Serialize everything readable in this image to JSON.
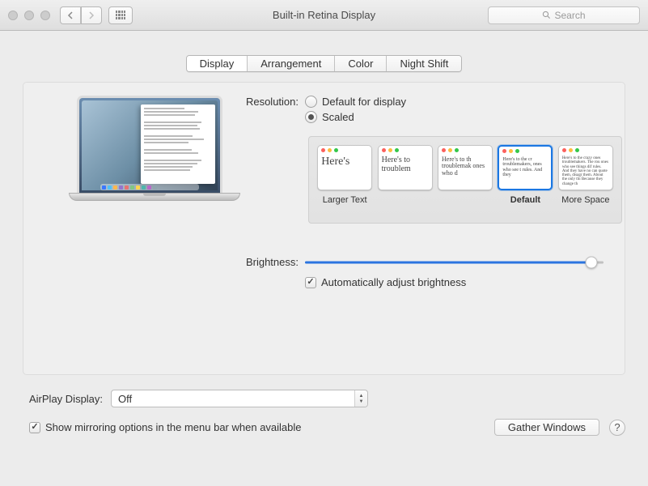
{
  "window": {
    "title": "Built-in Retina Display"
  },
  "search": {
    "placeholder": "Search"
  },
  "tabs": {
    "display": "Display",
    "arrangement": "Arrangement",
    "color": "Color",
    "night": "Night Shift"
  },
  "resolution": {
    "label": "Resolution:",
    "default_for_display": "Default for display",
    "scaled": "Scaled"
  },
  "thumbs": {
    "larger": {
      "caption": "Larger Text",
      "sample": "Here's"
    },
    "t2": {
      "sample": "Here's to troublem"
    },
    "t3": {
      "sample": "Here's to th troublemak ones who d"
    },
    "default": {
      "caption": "Default",
      "sample": "Here's to the cr troublemakers, ones who see t rules. And they"
    },
    "more": {
      "caption": "More Space",
      "sample": "Here's to the crazy ones troublemakers. The rou ones who see things dif rules. And they have no can quote them, disagr them. About the only thi Because they change th"
    }
  },
  "brightness": {
    "label": "Brightness:",
    "auto": "Automatically adjust brightness"
  },
  "airplay": {
    "label": "AirPlay Display:",
    "value": "Off"
  },
  "mirror": {
    "label": "Show mirroring options in the menu bar when available"
  },
  "gather": {
    "label": "Gather Windows"
  },
  "help": {
    "label": "?"
  }
}
